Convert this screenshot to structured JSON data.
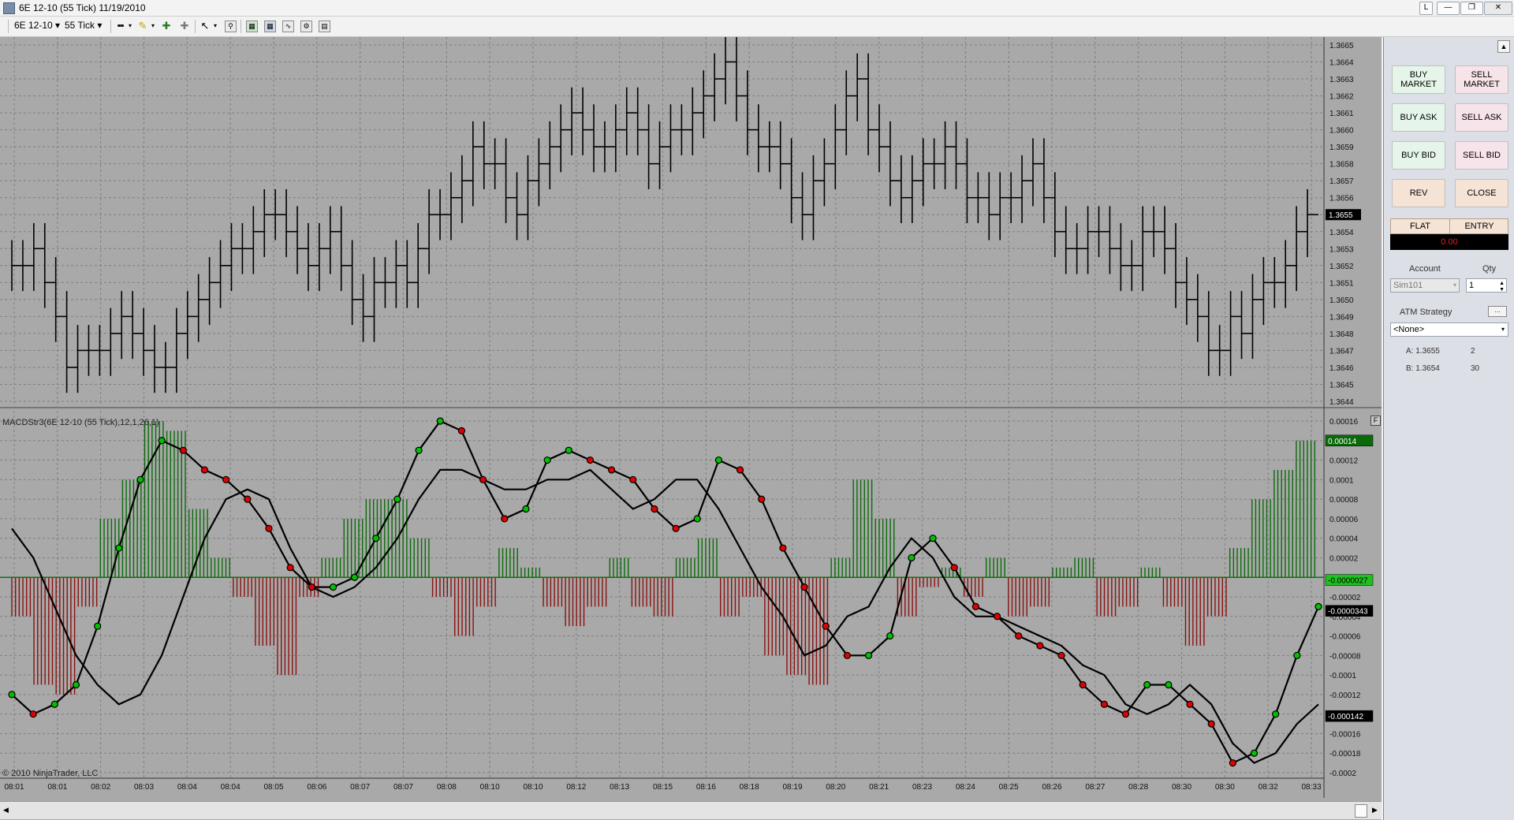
{
  "window": {
    "title": "6E 12-10 (55 Tick)  11/19/2010",
    "buttons": [
      "L",
      "—",
      "❐",
      "✕"
    ]
  },
  "toolbar": {
    "instrument": "6E 12-10",
    "interval": "55 Tick"
  },
  "chart": {
    "indicator_label": "MACDStr3(6E 12-10 (55 Tick),12,1,26,1)",
    "copyright": "© 2010 NinjaTrader, LLC",
    "panel_button": "F",
    "price_axis": [
      "1.3665",
      "1.3664",
      "1.3663",
      "1.3662",
      "1.3661",
      "1.3660",
      "1.3659",
      "1.3658",
      "1.3657",
      "1.3656",
      "1.3655",
      "1.3654",
      "1.3653",
      "1.3652",
      "1.3651",
      "1.3650",
      "1.3649",
      "1.3648",
      "1.3647",
      "1.3646",
      "1.3645",
      "1.3644"
    ],
    "last_price": "1.3655",
    "macd_axis": [
      "0.00016",
      "0.00014",
      "0.00012",
      "0.0001",
      "0.00008",
      "0.00006",
      "0.00004",
      "0.00002",
      "0",
      "-0.00002",
      "-0.00004",
      "-0.00006",
      "-0.00008",
      "-0.0001",
      "-0.00012",
      "-0.00014",
      "-0.00016",
      "-0.00018",
      "-0.0002"
    ],
    "macd_badges": {
      "top": "0.00014",
      "zero": "-0.0000027",
      "mid": "-0.0000343",
      "low": "-0.000142"
    },
    "time_axis": [
      "08:01",
      "08:01",
      "08:02",
      "08:03",
      "08:04",
      "08:04",
      "08:05",
      "08:06",
      "08:07",
      "08:07",
      "08:08",
      "08:10",
      "08:10",
      "08:12",
      "08:13",
      "08:15",
      "08:16",
      "08:18",
      "08:19",
      "08:20",
      "08:21",
      "08:23",
      "08:24",
      "08:25",
      "08:26",
      "08:27",
      "08:28",
      "08:30",
      "08:30",
      "08:32",
      "08:33"
    ],
    "colors": {
      "background": "#a9a9a9",
      "hist_pos": "#0a6a0a",
      "hist_neg": "#8a1010",
      "dot_up": "#00c000",
      "dot_down": "#e00000"
    }
  },
  "chart_data": {
    "type": "line",
    "series": [
      {
        "name": "price",
        "values": [
          1.3652,
          1.3652,
          1.3653,
          1.3651,
          1.3649,
          1.3646,
          1.3647,
          1.3647,
          1.3647,
          1.3648,
          1.3649,
          1.3648,
          1.3647,
          1.3646,
          1.3646,
          1.3648,
          1.3649,
          1.365,
          1.3651,
          1.3652,
          1.3653,
          1.3653,
          1.3654,
          1.3655,
          1.3655,
          1.3654,
          1.3653,
          1.3652,
          1.3653,
          1.3654,
          1.3652,
          1.365,
          1.3649,
          1.3651,
          1.3651,
          1.3652,
          1.3651,
          1.3653,
          1.3655,
          1.3655,
          1.3656,
          1.3657,
          1.3659,
          1.3658,
          1.3658,
          1.3656,
          1.3655,
          1.3657,
          1.3658,
          1.3659,
          1.366,
          1.3661,
          1.366,
          1.3659,
          1.3659,
          1.366,
          1.3661,
          1.366,
          1.3658,
          1.3659,
          1.366,
          1.366,
          1.3661,
          1.3662,
          1.3663,
          1.3664,
          1.3662,
          1.366,
          1.3659,
          1.3659,
          1.3658,
          1.3656,
          1.3655,
          1.3657,
          1.3658,
          1.366,
          1.3662,
          1.3663,
          1.366,
          1.3659,
          1.3657,
          1.3656,
          1.3657,
          1.3658,
          1.3658,
          1.3659,
          1.3658,
          1.3656,
          1.3656,
          1.3655,
          1.3656,
          1.3656,
          1.3657,
          1.3658,
          1.3656,
          1.3654,
          1.3653,
          1.3653,
          1.3654,
          1.3654,
          1.3653,
          1.3652,
          1.3652,
          1.3654,
          1.3654,
          1.3653,
          1.3651,
          1.365,
          1.3649,
          1.3647,
          1.3647,
          1.3649,
          1.3648,
          1.365,
          1.3651,
          1.3651,
          1.3652,
          1.3654,
          1.3655
        ]
      },
      {
        "name": "MACD",
        "values": [
          -0.00012,
          -0.00014,
          -0.00013,
          -0.00011,
          -5e-05,
          3e-05,
          0.0001,
          0.00014,
          0.00013,
          0.00011,
          0.0001,
          8e-05,
          5e-05,
          1e-05,
          -1e-05,
          -1e-05,
          0,
          4e-05,
          8e-05,
          0.00013,
          0.00016,
          0.00015,
          0.0001,
          6e-05,
          7e-05,
          0.00012,
          0.00013,
          0.00012,
          0.00011,
          0.0001,
          7e-05,
          5e-05,
          6e-05,
          0.00012,
          0.00011,
          8e-05,
          3e-05,
          -1e-05,
          -5e-05,
          -8e-05,
          -8e-05,
          -6e-05,
          2e-05,
          4e-05,
          1e-05,
          -3e-05,
          -4e-05,
          -6e-05,
          -7e-05,
          -8e-05,
          -0.00011,
          -0.00013,
          -0.00014,
          -0.00011,
          -0.00011,
          -0.00013,
          -0.00015,
          -0.00019,
          -0.00018,
          -0.00014,
          -8e-05,
          -3e-05
        ]
      },
      {
        "name": "Signal",
        "values": [
          5e-05,
          2e-05,
          -3e-05,
          -8e-05,
          -0.00011,
          -0.00013,
          -0.00012,
          -8e-05,
          -2e-05,
          4e-05,
          8e-05,
          9e-05,
          8e-05,
          3e-05,
          -1e-05,
          -2e-05,
          -1e-05,
          1e-05,
          4e-05,
          8e-05,
          0.00011,
          0.00011,
          0.0001,
          9e-05,
          9e-05,
          0.0001,
          0.0001,
          0.00011,
          9e-05,
          7e-05,
          8e-05,
          0.0001,
          0.0001,
          7e-05,
          3e-05,
          -1e-05,
          -4e-05,
          -8e-05,
          -7e-05,
          -4e-05,
          -3e-05,
          1e-05,
          4e-05,
          2e-05,
          -2e-05,
          -4e-05,
          -4e-05,
          -5e-05,
          -6e-05,
          -7e-05,
          -9e-05,
          -0.0001,
          -0.00013,
          -0.00014,
          -0.00013,
          -0.00011,
          -0.00013,
          -0.00017,
          -0.00019,
          -0.00018,
          -0.00015,
          -0.00013
        ]
      },
      {
        "name": "Histogram",
        "values": [
          -4e-05,
          -0.00011,
          -0.00012,
          -3e-05,
          6e-05,
          0.0001,
          0.00016,
          0.00015,
          7e-05,
          2e-05,
          -2e-05,
          -7e-05,
          -0.0001,
          -2e-05,
          2e-05,
          6e-05,
          8e-05,
          8e-05,
          4e-05,
          -2e-05,
          -6e-05,
          -3e-05,
          3e-05,
          1e-05,
          -3e-05,
          -5e-05,
          -3e-05,
          2e-05,
          -3e-05,
          -4e-05,
          2e-05,
          4e-05,
          -4e-05,
          -2e-05,
          -8e-05,
          -0.0001,
          -0.00011,
          2e-05,
          0.0001,
          6e-05,
          -4e-05,
          -1e-05,
          1e-05,
          -2e-05,
          2e-05,
          -4e-05,
          -3e-05,
          1e-05,
          2e-05,
          -4e-05,
          -3e-05,
          1e-05,
          -3e-05,
          -7e-05,
          -4e-05,
          3e-05,
          8e-05,
          0.00011,
          0.00014
        ]
      }
    ],
    "price_range": [
      1.3644,
      1.3665
    ],
    "macd_range": [
      -0.0002,
      0.00016
    ],
    "grid": true
  },
  "order_panel": {
    "buy_market": "BUY MARKET",
    "sell_market": "SELL MARKET",
    "buy_ask": "BUY ASK",
    "sell_ask": "SELL ASK",
    "buy_bid": "BUY BID",
    "sell_bid": "SELL BID",
    "rev": "REV",
    "close": "CLOSE",
    "flat": "FLAT",
    "entry": "ENTRY",
    "pnl": "0.00",
    "account_label": "Account",
    "qty_label": "Qty",
    "account_value": "Sim101",
    "qty_value": "1",
    "atm_label": "ATM Strategy",
    "atm_value": "<None>",
    "ask_label": "A: 1.3655",
    "ask_size": "2",
    "bid_label": "B: 1.3654",
    "bid_size": "30"
  }
}
